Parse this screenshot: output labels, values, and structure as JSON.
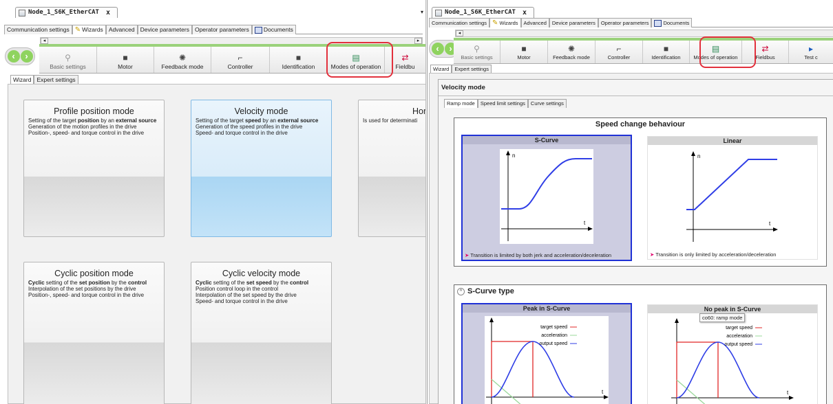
{
  "document_tab": {
    "title": "Node_1_S6K_EtherCAT",
    "close": "x"
  },
  "main_tabs": [
    "Communication settings",
    "Wizards",
    "Advanced",
    "Device parameters",
    "Operator parameters",
    "Documents"
  ],
  "toolbar_left": [
    "Basic settings",
    "Motor",
    "Feedback mode",
    "Controller",
    "Identification",
    "Modes of operation",
    "Fieldbu"
  ],
  "toolbar_right": [
    "Basic settings",
    "Motor",
    "Feedback mode",
    "Controller",
    "Identification",
    "Modes of operation",
    "Fieldbus",
    "Test c"
  ],
  "sub_tabs": [
    "Wizard",
    "Expert settings"
  ],
  "cards": [
    {
      "title": "Profile position mode",
      "lines": [
        "Setting of the target position by an external source",
        "Generation of the motion profiles in the drive",
        "Position-, speed- and torque control in the drive"
      ]
    },
    {
      "title": "Velocity mode",
      "lines": [
        "Setting of the target speed by an external source",
        "Generation of the speed profiles in the drive",
        "Speed- and torque control in the drive"
      ]
    },
    {
      "title": "Homi",
      "lines": [
        "Is used for determinati"
      ]
    },
    {
      "title": "Cyclic position mode",
      "lines": [
        "Cyclic setting of the set position by the control",
        "Interpolation of the set positions by the drive",
        "Position-, speed- and torque control in the drive"
      ]
    },
    {
      "title": "Cyclic velocity mode",
      "lines": [
        "Cyclic setting of the set speed by the control",
        "Position control loop in the control",
        "Interpolation of the set speed by the drive",
        "Speed- and torque control in the drive"
      ]
    }
  ],
  "right": {
    "section_title": "Velocity mode",
    "inner_tabs": [
      "Ramp mode",
      "Speed limit settings",
      "Curve settings"
    ],
    "speed_change": {
      "title": "Speed change behaviour",
      "scurve": {
        "title": "S-Curve",
        "note": "Transition is limited by both jerk and acceleration/deceleration"
      },
      "linear": {
        "title": "Linear",
        "note": "Transition is only limited by acceleration/deceleration"
      }
    },
    "scurve_type": {
      "title": "S-Curve type",
      "peak": {
        "title": "Peak in S-Curve"
      },
      "nopeak": {
        "title": "No peak in S-Curve"
      },
      "legend": [
        "target speed",
        "acceleration",
        "output speed"
      ],
      "tooltip": "co60: ramp mode"
    },
    "axis": {
      "n": "n",
      "t": "t"
    }
  },
  "colors": {
    "accent_green": "#8fd35f",
    "highlight_red": "#e2303c",
    "selected_blue": "#1f31d6"
  }
}
